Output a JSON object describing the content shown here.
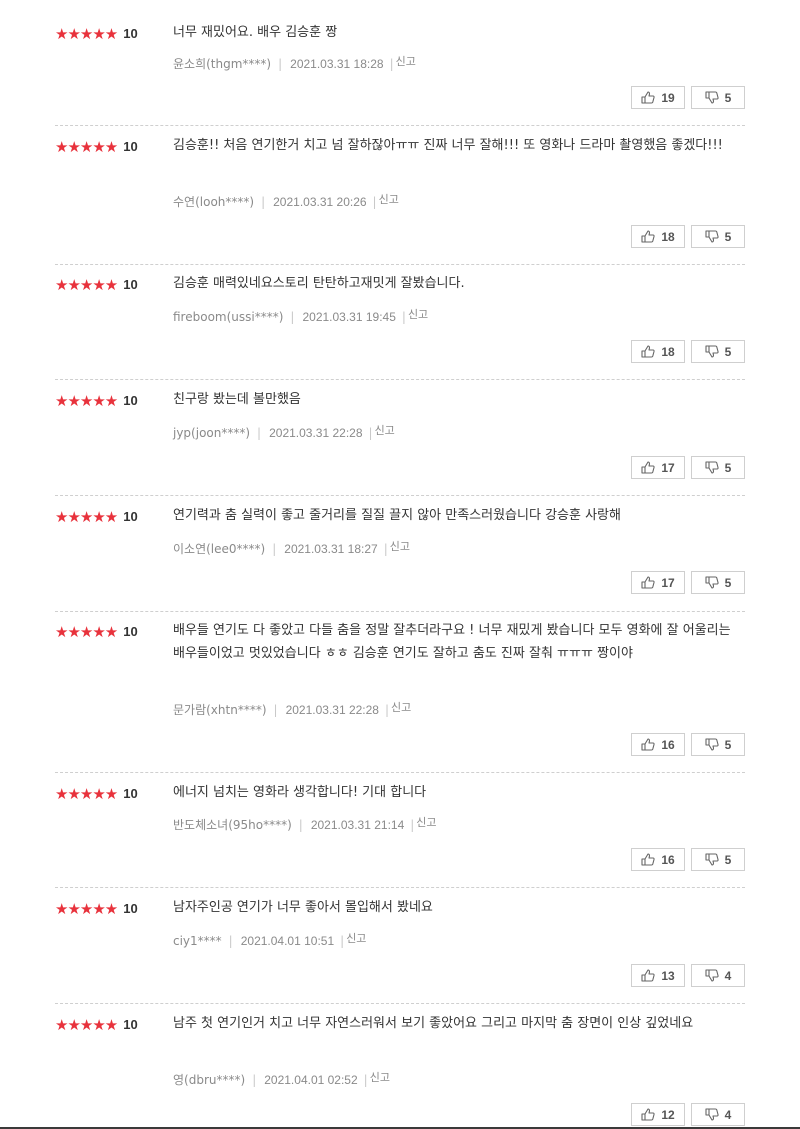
{
  "report_label": "신고",
  "star_glyphs": "★★★★★",
  "colors": {
    "star": "#e8323c",
    "text": "#333333",
    "meta": "#8a8a8a",
    "border": "#cfcfcf"
  },
  "reviews": [
    {
      "score": "10",
      "text": "너무 재밌어요. 배우 김승훈 짱",
      "author": "윤소희(thgm****)",
      "date": "2021.03.31 18:28",
      "likes": "19",
      "dislikes": "5"
    },
    {
      "score": "10",
      "text": "김승훈!! 처음 연기한거 치고 넘 잘하잖아ㅠㅠ 진짜 너무 잘해!!! 또 영화나 드라마 촬영했음 좋겠다!!!",
      "author": "수연(looh****)",
      "date": "2021.03.31 20:26",
      "likes": "18",
      "dislikes": "5"
    },
    {
      "score": "10",
      "text": "김승훈 매력있네요스토리 탄탄하고재밋게 잘봤습니다.",
      "author": "fireboom(ussi****)",
      "date": "2021.03.31 19:45",
      "likes": "18",
      "dislikes": "5"
    },
    {
      "score": "10",
      "text": "친구랑 봤는데 볼만했음",
      "author": "jyp(joon****)",
      "date": "2021.03.31 22:28",
      "likes": "17",
      "dislikes": "5"
    },
    {
      "score": "10",
      "text": "연기력과 춤 실력이 좋고 줄거리를 질질 끌지 않아 만족스러웠습니다 강승훈 사랑해",
      "author": "이소연(lee0****)",
      "date": "2021.03.31 18:27",
      "likes": "17",
      "dislikes": "5"
    },
    {
      "score": "10",
      "text": "배우들 연기도 다 좋았고 다들 춤을 정말 잘추더라구요 ! 너무 재밌게 봤습니다 모두 영화에 잘 어울리는 배우들이었고 멋있었습니다 ㅎㅎ 김승훈 연기도 잘하고 춤도 진짜 잘춰 ㅠㅠㅠ 짱이야",
      "author": "문가람(xhtn****)",
      "date": "2021.03.31 22:28",
      "likes": "16",
      "dislikes": "5"
    },
    {
      "score": "10",
      "text": "에너지 넘치는 영화라 생각합니다! 기대 합니다",
      "author": "반도체소녀(95ho****)",
      "date": "2021.03.31 21:14",
      "likes": "16",
      "dislikes": "5"
    },
    {
      "score": "10",
      "text": "남자주인공 연기가 너무 좋아서 몰입해서 봤네요",
      "author": "ciy1****",
      "date": "2021.04.01 10:51",
      "likes": "13",
      "dislikes": "4"
    },
    {
      "score": "10",
      "text": "남주 첫 연기인거 치고 너무 자연스러워서 보기 좋았어요 그리고 마지막 춤 장면이 인상 깊었네요",
      "author": "영(dbru****)",
      "date": "2021.04.01 02:52",
      "likes": "12",
      "dislikes": "4"
    }
  ]
}
